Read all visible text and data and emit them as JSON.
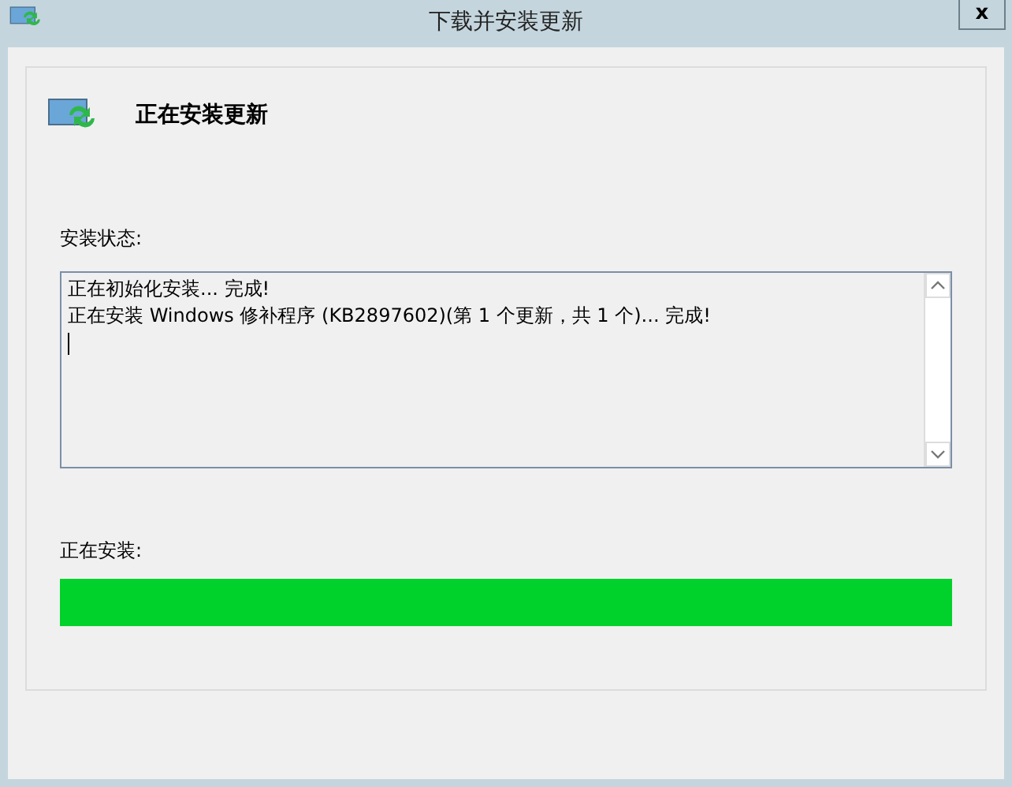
{
  "window": {
    "title": "下载并安装更新",
    "close_label": "x"
  },
  "header": {
    "title": "正在安装更新"
  },
  "status": {
    "label": "安装状态:",
    "lines": [
      "正在初始化安装... 完成!",
      "正在安装 Windows 修补程序 (KB2897602)(第 1 个更新，共 1 个)... 完成!"
    ]
  },
  "progress": {
    "label": "正在安装:",
    "level": 1
  }
}
